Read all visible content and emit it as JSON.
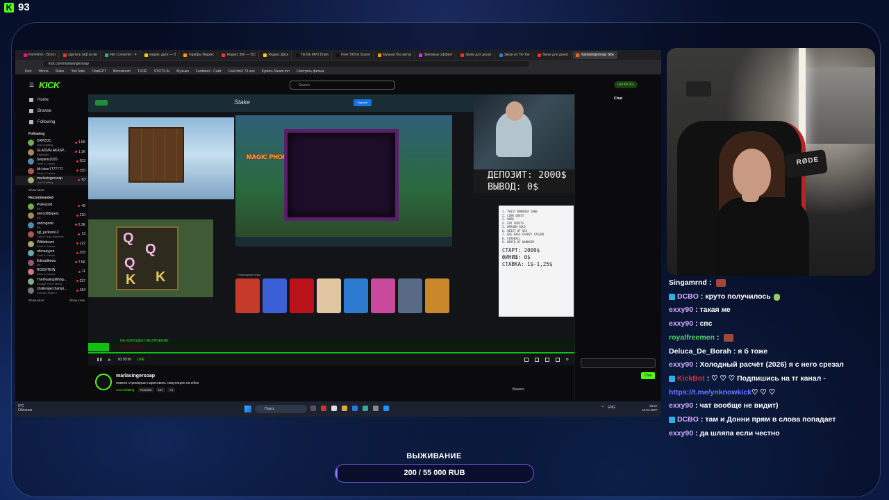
{
  "overlay": {
    "kick_count": "93",
    "goal": {
      "title": "ВЫЖИВАНИЕ",
      "text": "200 / 55 000 RUB",
      "current": 200,
      "target": 55000
    }
  },
  "browser": {
    "tabs": [
      "FanFilmX - Всего",
      "сделать гиф из ви",
      "File Converter - F",
      "яндекс диск — б",
      "Тарифы Яндекс",
      "Яндекс 360 — ОС",
      "Яндекс Диск",
      "TikTok MP3 Down",
      "Free TikTok Sound",
      "Музыка без автор",
      "Звуковые эффект",
      "Звуки для донат",
      "Звуки из Tik-Tok",
      "Звуки для донат",
      "marlasingersoap Stre"
    ],
    "url": "kick.com/marlasingersoap",
    "bookmarks": [
      "Kick",
      "Winna",
      "Stake",
      "YouTube",
      "ChatGPT",
      "Bonusinum",
      "TVОЁ",
      "SYRTX.AI",
      "Музыка",
      "Fanbetes - Сайт",
      "FanFilmX 73 ное",
      "Купить Steam ton",
      "Смотреть фильм"
    ]
  },
  "kick": {
    "logo": "KICK",
    "search_placeholder": "Search",
    "get_kicks": "Get KICKs",
    "nav": [
      "Home",
      "Browse",
      "Following"
    ],
    "following_title": "Following",
    "following": [
      {
        "name": "DRPZDC",
        "category": "Just Chatting",
        "viewers": "1.5K"
      },
      {
        "name": "GLADVALAKASP...",
        "category": "Keyboard",
        "viewers": "1.1K"
      },
      {
        "name": "Serpens2025",
        "category": "Slots & Casino",
        "viewers": "202"
      },
      {
        "name": "MrJoker7777777",
        "category": "Slots & Casino",
        "viewers": "150"
      },
      {
        "name": "marlasingersoap",
        "category": "Just Chatting",
        "viewers": "63"
      }
    ],
    "show_more": "Show More",
    "show_less": "Show Less",
    "recommended_title": "Recommended",
    "recommended": [
      {
        "name": "PGFworld",
        "category": "IRL",
        "viewers": "45"
      },
      {
        "name": "mercoffdeperc",
        "category": "IRL",
        "viewers": "210"
      },
      {
        "name": "andrognelc",
        "category": "IRL",
        "viewers": "2.3K"
      },
      {
        "name": "sgl_jackson12",
        "category": "Call of Duty: Warzone",
        "viewers": "13"
      },
      {
        "name": "Wittiebears",
        "category": "Slots & Casino",
        "viewers": "122"
      },
      {
        "name": "uhmaayyze",
        "category": "Slots & Casino",
        "viewers": "105"
      },
      {
        "name": "Edmatthews",
        "category": "IRL",
        "viewers": "7.5K"
      },
      {
        "name": "ROGHTEIN",
        "category": "Slots & Casino",
        "viewers": "11"
      },
      {
        "name": "TheHealingWhisp...",
        "category": "Escape From Tarkov",
        "viewers": "237"
      },
      {
        "name": "challengerchampi...",
        "category": "Counter-Strike 2",
        "viewers": "184"
      }
    ],
    "chat_header": "Chat",
    "chat_send": "Chat",
    "streamer": {
      "name": "marlasingersoap",
      "title": "помоги стримерше нарисовать симуляцию на юбке",
      "category": "Just Chatting",
      "tags": [
        "Russian",
        "18+",
        "+1"
      ],
      "viewers_label": "Viewers"
    },
    "player": {
      "time": "00:36:56",
      "live": "LIVE"
    }
  },
  "stream_scene": {
    "stake_logo": "Stake",
    "deposit_btn": "Deposit",
    "slot_title": "MAGIC PHOENIX",
    "deposit_line": "ДЕПОЗИТ: 2000$",
    "withdraw_line": "ВЫВОД: 0$",
    "notes_list": [
      "1. TWIST BONANZA 1000",
      "2. LINK QUEST",
      "3. ROOK",
      "4. FRY FRUITS",
      "5. DRAGON GOLD",
      "6. HEIST OF SEA",
      "7. BIG BASS FRENZY CASINO",
      "8. FIREBALL",
      "9. WRATH OF WANNSEM"
    ],
    "notes_start": "СТАРТ: 2000$",
    "notes_finish": "ФИНИШ: 0$",
    "notes_bet": "СТАВКА: 1$-1,25$",
    "ticker_top": "НА ХОРОШЕЕ НАСТРОЕНИЕ",
    "thumbs_title": "Популярные игры",
    "games": [
      "MUNCHY MILO",
      "LAB LEAK",
      "JAYFIER DROP",
      "FRUIT BONANZA",
      "SUGAR RUSH",
      "PUNK ROCKER 2",
      "ZOMBIE CLUSTER"
    ]
  },
  "taskbar": {
    "weather_temp": "0°C",
    "weather_desc": "Облачно",
    "search": "Поиск",
    "lang": "ENG",
    "time": "20:27",
    "date": "18.04.2027"
  },
  "overlay_chat": [
    {
      "user": "Singamrnd",
      "color": "#ffffff",
      "text": "",
      "emote": true
    },
    {
      "user": "DCBO",
      "color": "#d6b0ff",
      "badge": true,
      "text": "круто получилось",
      "emote_sm": true
    },
    {
      "user": "exxy90",
      "color": "#d7a8ff",
      "text": "такая же"
    },
    {
      "user": "exxy90",
      "color": "#d7a8ff",
      "text": "спс"
    },
    {
      "user": "royalfreemen",
      "color": "#4fd36b",
      "text": "",
      "emote": true
    },
    {
      "user": "Deluca_De_Borah",
      "color": "#ffffff",
      "text": "я б тоже"
    },
    {
      "user": "exxy90",
      "color": "#d7a8ff",
      "text": "Холодный расчёт (2026) я с него срезал"
    },
    {
      "user": "KickBot",
      "color": "#e03030",
      "badge": true,
      "text": "♡ ♡ ♡ Подпишись на тг канал -"
    },
    {
      "user": "",
      "color": "#6a78ff",
      "text": "",
      "link": "https://t.me/ynknowkick",
      "suffix": " ♡ ♡ ♡"
    },
    {
      "user": "exxy90",
      "color": "#d7a8ff",
      "text": "чат вообще не видит)"
    },
    {
      "user": "DCBO",
      "color": "#d6b0ff",
      "badge": true,
      "text": "там и Донни прям в слова попадает"
    },
    {
      "user": "exxy90",
      "color": "#d7a8ff",
      "text": "да шляпа если честно"
    }
  ],
  "colors": {
    "kick_green": "#53fc18",
    "goal_accent": "#8a78ff"
  }
}
